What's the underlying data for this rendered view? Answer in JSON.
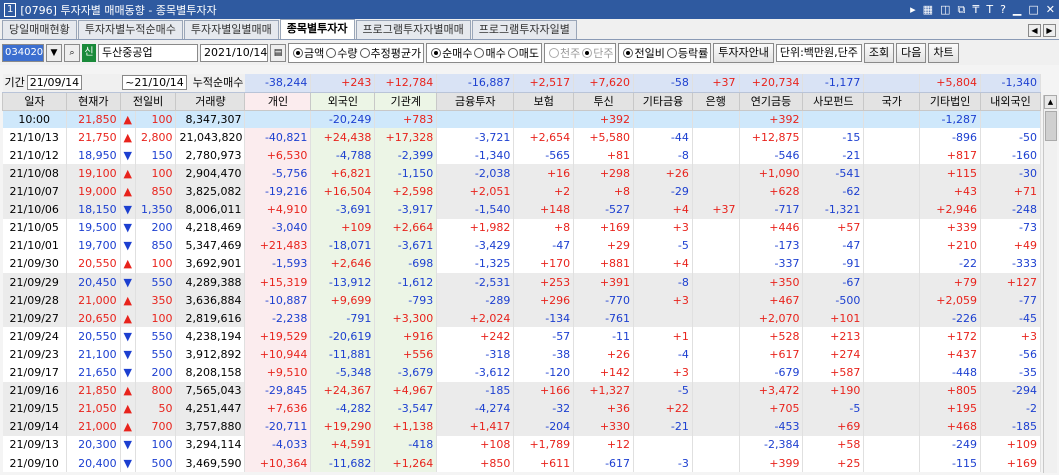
{
  "window": {
    "number": "1",
    "title": "[0796] 투자자별 매매동향 - 종목별투자자",
    "icons": [
      "arrow-right-icon",
      "chart-icon",
      "window-icon",
      "copy-icon",
      "pin-icon",
      "font-icon",
      "help-icon",
      "minimize-icon",
      "maximize-icon",
      "close-icon"
    ]
  },
  "tabs": [
    "당일매매현황",
    "투자자별누적순매수",
    "투자자별일별매매",
    "종목별투자자",
    "프로그램투자자별매매",
    "프로그램투자자일별"
  ],
  "toolbar": {
    "code": "034020",
    "badge": "신",
    "name": "두산중공업",
    "date": "2021/10/14",
    "g1": [
      "금액",
      "수량",
      "추정평균가"
    ],
    "g2": [
      "순매수",
      "매수",
      "매도"
    ],
    "g3": [
      "천주",
      "단주"
    ],
    "g4": [
      "전일비",
      "등락률"
    ],
    "guide": "투자자안내",
    "unit": "단위:백만원,단주",
    "query": "조회",
    "next": "다음",
    "chart": "차트"
  },
  "period": {
    "label": "기간",
    "from": "21/09/14",
    "to": "21/10/14",
    "sum_label": "누적순매수"
  },
  "sums": [
    "-38,244",
    "+243",
    "+12,784",
    "-16,887",
    "+2,517",
    "+7,620",
    "-58",
    "+37",
    "+20,734",
    "-1,177",
    "",
    "+5,804",
    "-1,340"
  ],
  "headers": [
    "일자",
    "현재가",
    "전일비",
    "거래량",
    "개인",
    "외국인",
    "기관계",
    "금융투자",
    "보험",
    "투신",
    "기타금융",
    "은행",
    "연기금등",
    "사모펀드",
    "국가",
    "기타법인",
    "내외국인"
  ],
  "rows": [
    [
      "10:00",
      "21,850",
      "▲",
      "100",
      "8,347,307",
      "",
      "-20,249",
      "+783",
      "",
      "",
      "+392",
      "",
      "",
      "+392",
      "",
      "",
      "-1,287",
      ""
    ],
    [
      "21/10/13",
      "21,750",
      "▲",
      "2,800",
      "21,043,820",
      "-40,821",
      "+24,438",
      "+17,328",
      "-3,721",
      "+2,654",
      "+5,580",
      "-44",
      "",
      "+12,875",
      "-15",
      "",
      "-896",
      "-50"
    ],
    [
      "21/10/12",
      "18,950",
      "▼",
      "150",
      "2,780,973",
      "+6,530",
      "-4,788",
      "-2,399",
      "-1,340",
      "-565",
      "+81",
      "-8",
      "",
      "-546",
      "-21",
      "",
      "+817",
      "-160"
    ],
    [
      "21/10/08",
      "19,100",
      "▲",
      "100",
      "2,904,470",
      "-5,756",
      "+6,821",
      "-1,150",
      "-2,038",
      "+16",
      "+298",
      "+26",
      "",
      "+1,090",
      "-541",
      "",
      "+115",
      "-30"
    ],
    [
      "21/10/07",
      "19,000",
      "▲",
      "850",
      "3,825,082",
      "-19,216",
      "+16,504",
      "+2,598",
      "+2,051",
      "+2",
      "+8",
      "-29",
      "",
      "+628",
      "-62",
      "",
      "+43",
      "+71"
    ],
    [
      "21/10/06",
      "18,150",
      "▼",
      "1,350",
      "8,006,011",
      "+4,910",
      "-3,691",
      "-3,917",
      "-1,540",
      "+148",
      "-527",
      "+4",
      "+37",
      "-717",
      "-1,321",
      "",
      "+2,946",
      "-248"
    ],
    [
      "21/10/05",
      "19,500",
      "▼",
      "200",
      "4,218,469",
      "-3,040",
      "+109",
      "+2,664",
      "+1,982",
      "+8",
      "+169",
      "+3",
      "",
      "+446",
      "+57",
      "",
      "+339",
      "-73"
    ],
    [
      "21/10/01",
      "19,700",
      "▼",
      "850",
      "5,347,469",
      "+21,483",
      "-18,071",
      "-3,671",
      "-3,429",
      "-47",
      "+29",
      "-5",
      "",
      "-173",
      "-47",
      "",
      "+210",
      "+49"
    ],
    [
      "21/09/30",
      "20,550",
      "▲",
      "100",
      "3,692,901",
      "-1,593",
      "+2,646",
      "-698",
      "-1,325",
      "+170",
      "+881",
      "+4",
      "",
      "-337",
      "-91",
      "",
      "-22",
      "-333"
    ],
    [
      "21/09/29",
      "20,450",
      "▼",
      "550",
      "4,289,388",
      "+15,319",
      "-13,912",
      "-1,612",
      "-2,531",
      "+253",
      "+391",
      "-8",
      "",
      "+350",
      "-67",
      "",
      "+79",
      "+127"
    ],
    [
      "21/09/28",
      "21,000",
      "▲",
      "350",
      "3,636,884",
      "-10,887",
      "+9,699",
      "-793",
      "-289",
      "+296",
      "-770",
      "+3",
      "",
      "+467",
      "-500",
      "",
      "+2,059",
      "-77"
    ],
    [
      "21/09/27",
      "20,650",
      "▲",
      "100",
      "2,819,616",
      "-2,238",
      "-791",
      "+3,300",
      "+2,024",
      "-134",
      "-761",
      "",
      "",
      "+2,070",
      "+101",
      "",
      "-226",
      "-45"
    ],
    [
      "21/09/24",
      "20,550",
      "▼",
      "550",
      "4,238,194",
      "+19,529",
      "-20,619",
      "+916",
      "+242",
      "-57",
      "-11",
      "+1",
      "",
      "+528",
      "+213",
      "",
      "+172",
      "+3"
    ],
    [
      "21/09/23",
      "21,100",
      "▼",
      "550",
      "3,912,892",
      "+10,944",
      "-11,881",
      "+556",
      "-318",
      "-38",
      "+26",
      "-4",
      "",
      "+617",
      "+274",
      "",
      "+437",
      "-56"
    ],
    [
      "21/09/17",
      "21,650",
      "▼",
      "200",
      "8,208,158",
      "+9,510",
      "-5,348",
      "-3,679",
      "-3,612",
      "-120",
      "+142",
      "+3",
      "",
      "-679",
      "+587",
      "",
      "-448",
      "-35"
    ],
    [
      "21/09/16",
      "21,850",
      "▲",
      "800",
      "7,565,043",
      "-29,845",
      "+24,367",
      "+4,967",
      "-185",
      "+166",
      "+1,327",
      "-5",
      "",
      "+3,472",
      "+190",
      "",
      "+805",
      "-294"
    ],
    [
      "21/09/15",
      "21,050",
      "▲",
      "50",
      "4,251,447",
      "+7,636",
      "-4,282",
      "-3,547",
      "-4,274",
      "-32",
      "+36",
      "+22",
      "",
      "+705",
      "-5",
      "",
      "+195",
      "-2"
    ],
    [
      "21/09/14",
      "21,000",
      "▲",
      "700",
      "3,757,880",
      "-20,711",
      "+19,290",
      "+1,138",
      "+1,417",
      "-204",
      "+330",
      "-21",
      "",
      "-453",
      "+69",
      "",
      "+468",
      "-185"
    ],
    [
      "21/09/13",
      "20,300",
      "▼",
      "100",
      "3,294,114",
      "-4,033",
      "+4,591",
      "-418",
      "+108",
      "+1,789",
      "+12",
      "",
      "",
      "-2,384",
      "+58",
      "",
      "-249",
      "+109"
    ],
    [
      "21/09/10",
      "20,400",
      "▼",
      "500",
      "3,469,590",
      "+10,364",
      "-11,682",
      "+1,264",
      "+850",
      "+611",
      "-617",
      "-3",
      "",
      "+399",
      "+25",
      "",
      "-115",
      "+169"
    ]
  ]
}
